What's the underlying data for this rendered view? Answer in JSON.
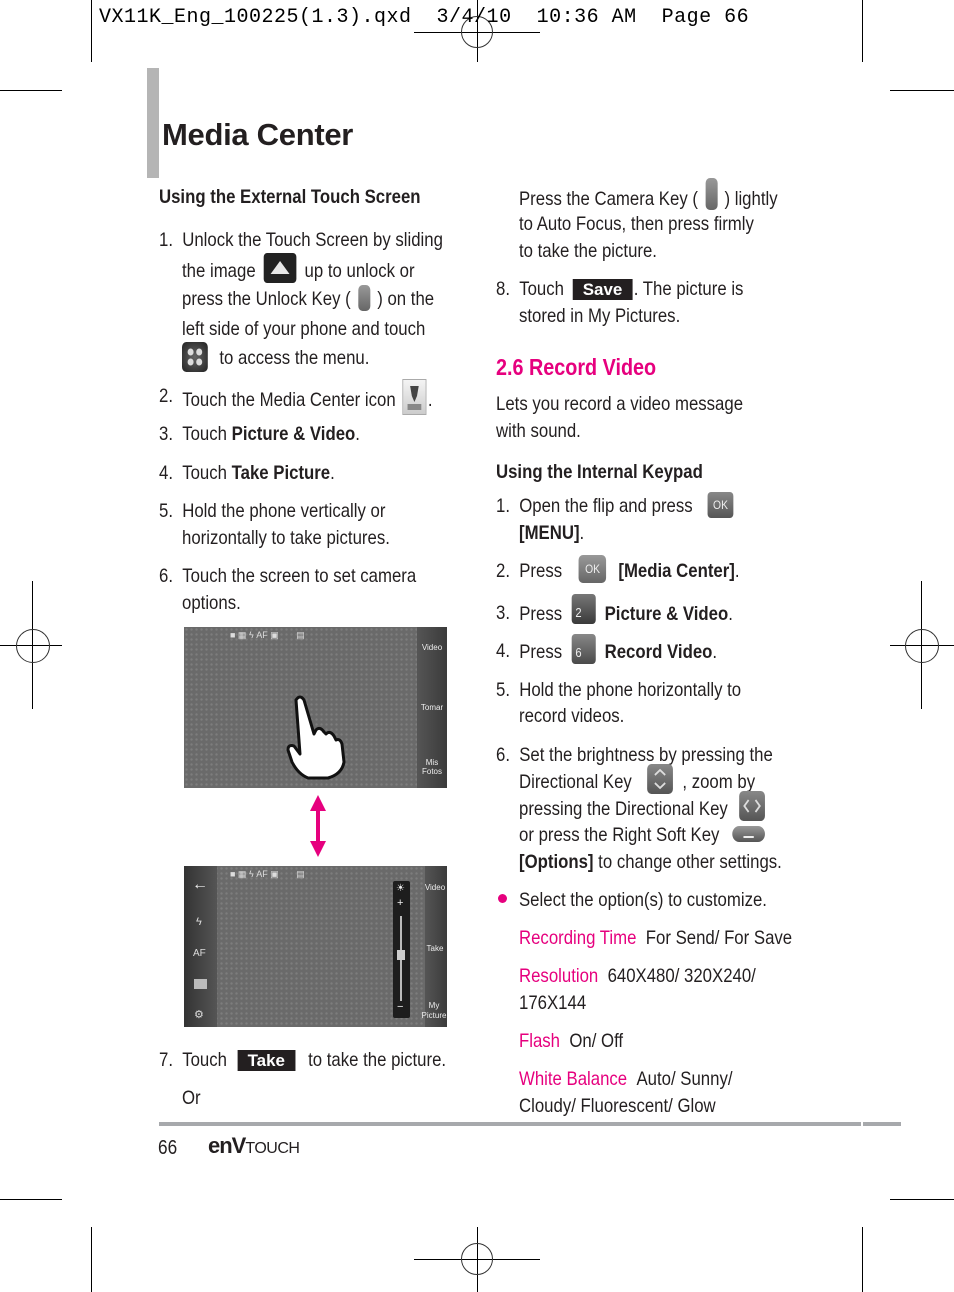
{
  "slug": "VX11K_Eng_100225(1.3).qxd  3/4/10  10:36 AM  Page 66",
  "page_title": "Media Center",
  "left": {
    "subheading": "Using the External Touch Screen",
    "step1": {
      "num": "1.",
      "l1": "Unlock the Touch Screen by sliding",
      "l2a": "the image",
      "l2b": "up to unlock or",
      "l3a": "press the Unlock Key (",
      "l3b": ") on the",
      "l4": "left side of your phone and touch",
      "l5": "to access the menu."
    },
    "step2": {
      "num": "2.",
      "text": "Touch the Media Center icon",
      "end": "."
    },
    "step3": {
      "num": "3.",
      "pre": "Touch ",
      "bold": "Picture & Video",
      "end": "."
    },
    "step4": {
      "num": "4.",
      "pre": "Touch ",
      "bold": "Take Picture",
      "end": "."
    },
    "step5": {
      "num": "5.",
      "l1": "Hold the phone vertically or",
      "l2": "horizontally to take pictures."
    },
    "step6": {
      "num": "6.",
      "l1": "Touch the screen to set camera",
      "l2": "options."
    },
    "screen1": {
      "labels": [
        "Video",
        "Tomar",
        "Mis Fotos"
      ]
    },
    "screen2": {
      "labels": [
        "Video",
        "Take",
        "My Picture"
      ],
      "left_icons": [
        "back-arrow",
        "flash",
        "AF",
        "preview",
        "settings"
      ],
      "af": "AF"
    },
    "step7": {
      "num": "7.",
      "pre": "Touch",
      "button": "Take",
      "post": "to take the picture."
    },
    "or": "Or"
  },
  "right": {
    "cont": {
      "l1a": "Press the Camera Key (",
      "l1b": ") lightly",
      "l2": "to Auto Focus, then press firmly",
      "l3": "to take the picture."
    },
    "step8": {
      "num": "8.",
      "pre": "Touch",
      "button": "Save",
      "post": ". The picture is",
      "l2": "stored in My Pictures."
    },
    "section_title": "2.6 Record Video",
    "intro": {
      "l1": "Lets you record a video message",
      "l2": "with sound."
    },
    "subheading": "Using the Internal Keypad",
    "s1": {
      "num": "1.",
      "text": "Open the flip and press",
      "bold": "[MENU]",
      "end": ".",
      "key": "OK"
    },
    "s2": {
      "num": "2.",
      "text": "Press",
      "bold": "[Media Center]",
      "end": ".",
      "key": "OK"
    },
    "s3": {
      "num": "3.",
      "text": "Press",
      "bold": "Picture & Video",
      "end": ".",
      "key": "2"
    },
    "s4": {
      "num": "4.",
      "text": "Press",
      "bold": "Record Video",
      "end": ".",
      "key": "6"
    },
    "s5": {
      "num": "5.",
      "l1": "Hold the phone horizontally to",
      "l2": "record videos."
    },
    "s6": {
      "num": "6.",
      "l1": "Set the brightness by pressing the",
      "l2a": "Directional Key",
      "l2b": ", zoom by",
      "l3": "pressing the Directional Key",
      "l4": "or press the Right Soft Key",
      "l5bold": "[Options]",
      "l5": " to change other settings."
    },
    "bullet": "Select the option(s) to customize.",
    "options": [
      {
        "label": "Recording Time",
        "value": "For Send/ For Save"
      },
      {
        "label": "Resolution",
        "value": "640X480/ 320X240/",
        "value2": "176X144"
      },
      {
        "label": "Flash",
        "value": "On/ Off"
      },
      {
        "label": "White Balance",
        "value": "Auto/ Sunny/",
        "value2": "Cloudy/ Fluorescent/ Glow"
      }
    ]
  },
  "footer": {
    "page_number": "66",
    "logo_env": "enV",
    "logo_touch": "TOUCH"
  },
  "colors": {
    "accent": "#e6007e",
    "text": "#231f20",
    "rule": "#a7a9ac"
  }
}
